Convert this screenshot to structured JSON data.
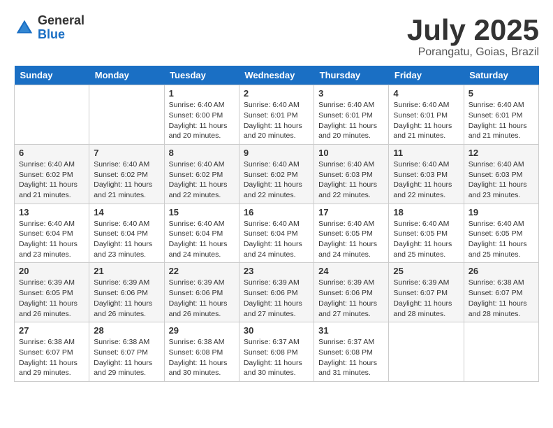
{
  "header": {
    "logo_general": "General",
    "logo_blue": "Blue",
    "title": "July 2025",
    "location": "Porangatu, Goias, Brazil"
  },
  "calendar": {
    "days_of_week": [
      "Sunday",
      "Monday",
      "Tuesday",
      "Wednesday",
      "Thursday",
      "Friday",
      "Saturday"
    ],
    "weeks": [
      [
        {
          "day": "",
          "info": ""
        },
        {
          "day": "",
          "info": ""
        },
        {
          "day": "1",
          "info": "Sunrise: 6:40 AM\nSunset: 6:00 PM\nDaylight: 11 hours\nand 20 minutes."
        },
        {
          "day": "2",
          "info": "Sunrise: 6:40 AM\nSunset: 6:01 PM\nDaylight: 11 hours\nand 20 minutes."
        },
        {
          "day": "3",
          "info": "Sunrise: 6:40 AM\nSunset: 6:01 PM\nDaylight: 11 hours\nand 20 minutes."
        },
        {
          "day": "4",
          "info": "Sunrise: 6:40 AM\nSunset: 6:01 PM\nDaylight: 11 hours\nand 21 minutes."
        },
        {
          "day": "5",
          "info": "Sunrise: 6:40 AM\nSunset: 6:01 PM\nDaylight: 11 hours\nand 21 minutes."
        }
      ],
      [
        {
          "day": "6",
          "info": "Sunrise: 6:40 AM\nSunset: 6:02 PM\nDaylight: 11 hours\nand 21 minutes."
        },
        {
          "day": "7",
          "info": "Sunrise: 6:40 AM\nSunset: 6:02 PM\nDaylight: 11 hours\nand 21 minutes."
        },
        {
          "day": "8",
          "info": "Sunrise: 6:40 AM\nSunset: 6:02 PM\nDaylight: 11 hours\nand 22 minutes."
        },
        {
          "day": "9",
          "info": "Sunrise: 6:40 AM\nSunset: 6:02 PM\nDaylight: 11 hours\nand 22 minutes."
        },
        {
          "day": "10",
          "info": "Sunrise: 6:40 AM\nSunset: 6:03 PM\nDaylight: 11 hours\nand 22 minutes."
        },
        {
          "day": "11",
          "info": "Sunrise: 6:40 AM\nSunset: 6:03 PM\nDaylight: 11 hours\nand 22 minutes."
        },
        {
          "day": "12",
          "info": "Sunrise: 6:40 AM\nSunset: 6:03 PM\nDaylight: 11 hours\nand 23 minutes."
        }
      ],
      [
        {
          "day": "13",
          "info": "Sunrise: 6:40 AM\nSunset: 6:04 PM\nDaylight: 11 hours\nand 23 minutes."
        },
        {
          "day": "14",
          "info": "Sunrise: 6:40 AM\nSunset: 6:04 PM\nDaylight: 11 hours\nand 23 minutes."
        },
        {
          "day": "15",
          "info": "Sunrise: 6:40 AM\nSunset: 6:04 PM\nDaylight: 11 hours\nand 24 minutes."
        },
        {
          "day": "16",
          "info": "Sunrise: 6:40 AM\nSunset: 6:04 PM\nDaylight: 11 hours\nand 24 minutes."
        },
        {
          "day": "17",
          "info": "Sunrise: 6:40 AM\nSunset: 6:05 PM\nDaylight: 11 hours\nand 24 minutes."
        },
        {
          "day": "18",
          "info": "Sunrise: 6:40 AM\nSunset: 6:05 PM\nDaylight: 11 hours\nand 25 minutes."
        },
        {
          "day": "19",
          "info": "Sunrise: 6:40 AM\nSunset: 6:05 PM\nDaylight: 11 hours\nand 25 minutes."
        }
      ],
      [
        {
          "day": "20",
          "info": "Sunrise: 6:39 AM\nSunset: 6:05 PM\nDaylight: 11 hours\nand 26 minutes."
        },
        {
          "day": "21",
          "info": "Sunrise: 6:39 AM\nSunset: 6:06 PM\nDaylight: 11 hours\nand 26 minutes."
        },
        {
          "day": "22",
          "info": "Sunrise: 6:39 AM\nSunset: 6:06 PM\nDaylight: 11 hours\nand 26 minutes."
        },
        {
          "day": "23",
          "info": "Sunrise: 6:39 AM\nSunset: 6:06 PM\nDaylight: 11 hours\nand 27 minutes."
        },
        {
          "day": "24",
          "info": "Sunrise: 6:39 AM\nSunset: 6:06 PM\nDaylight: 11 hours\nand 27 minutes."
        },
        {
          "day": "25",
          "info": "Sunrise: 6:39 AM\nSunset: 6:07 PM\nDaylight: 11 hours\nand 28 minutes."
        },
        {
          "day": "26",
          "info": "Sunrise: 6:38 AM\nSunset: 6:07 PM\nDaylight: 11 hours\nand 28 minutes."
        }
      ],
      [
        {
          "day": "27",
          "info": "Sunrise: 6:38 AM\nSunset: 6:07 PM\nDaylight: 11 hours\nand 29 minutes."
        },
        {
          "day": "28",
          "info": "Sunrise: 6:38 AM\nSunset: 6:07 PM\nDaylight: 11 hours\nand 29 minutes."
        },
        {
          "day": "29",
          "info": "Sunrise: 6:38 AM\nSunset: 6:08 PM\nDaylight: 11 hours\nand 30 minutes."
        },
        {
          "day": "30",
          "info": "Sunrise: 6:37 AM\nSunset: 6:08 PM\nDaylight: 11 hours\nand 30 minutes."
        },
        {
          "day": "31",
          "info": "Sunrise: 6:37 AM\nSunset: 6:08 PM\nDaylight: 11 hours\nand 31 minutes."
        },
        {
          "day": "",
          "info": ""
        },
        {
          "day": "",
          "info": ""
        }
      ]
    ]
  }
}
